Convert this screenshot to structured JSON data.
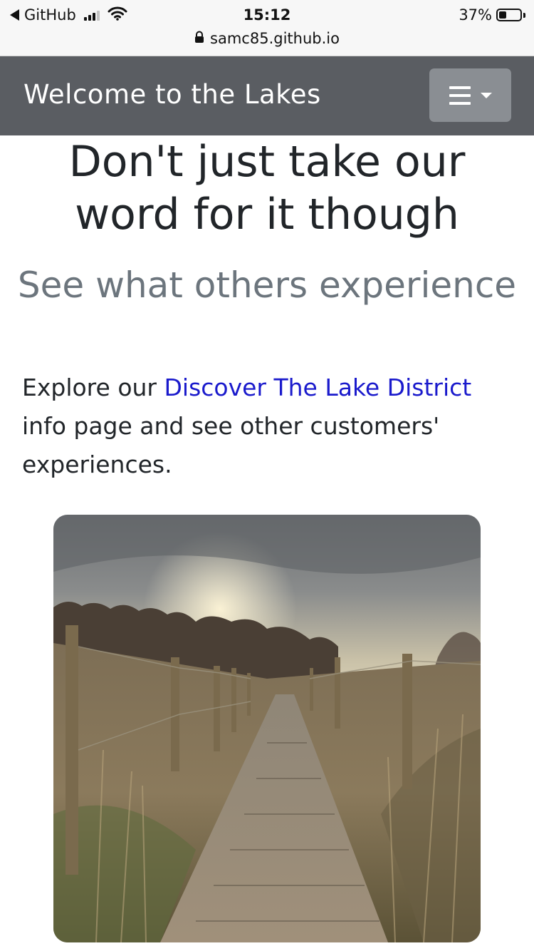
{
  "status_bar": {
    "back_app": "GitHub",
    "time": "15:12",
    "battery": "37%",
    "url": "samc85.github.io"
  },
  "icons": {
    "back": "back-triangle-icon",
    "signal": "cellular-signal-icon",
    "wifi": "wifi-icon",
    "battery": "battery-icon",
    "lock": "lock-icon",
    "menu": "hamburger-menu-icon",
    "dropdown": "caret-down-icon"
  },
  "navbar": {
    "brand": "Welcome to the Lakes",
    "background": "#5a5d62",
    "toggler_background": "#8a8e93"
  },
  "content": {
    "heading": "Don't just take our word for it though",
    "subheading": "See what others experience",
    "paragraph_before": "Explore our ",
    "link_text": "Discover The Lake District",
    "paragraph_after": " info page and see other customers' experiences.",
    "link_color": "#1a1acc"
  },
  "photo": {
    "subject": "wooden boardwalk path through dune grass with fence posts under a cloudy sky"
  }
}
